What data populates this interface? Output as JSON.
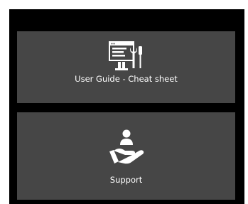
{
  "tiles": [
    {
      "label": "User Guide - Cheat sheet",
      "icon": "guide-tools-icon"
    },
    {
      "label": "Support",
      "icon": "support-hand-icon"
    }
  ],
  "colors": {
    "frame": "#000000",
    "tile_background": "#464646",
    "text": "#ffffff"
  }
}
